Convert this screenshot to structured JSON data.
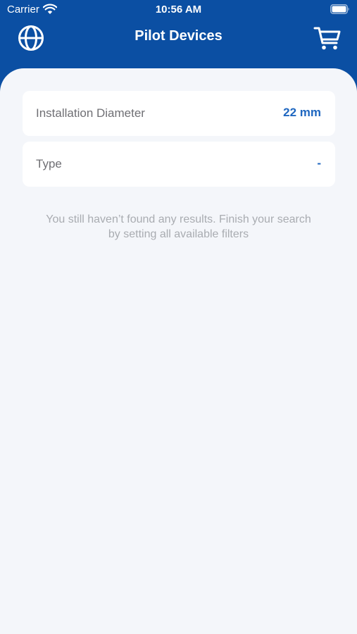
{
  "status_bar": {
    "carrier": "Carrier",
    "time": "10:56 AM"
  },
  "nav": {
    "title": "Pilot Devices",
    "left_icon": "globe-icon",
    "right_icon": "cart-icon"
  },
  "filters": [
    {
      "label": "Installation Diameter",
      "value": "22 mm"
    },
    {
      "label": "Type",
      "value": "-"
    }
  ],
  "empty_message": "You still haven’t found any results. Finish your search by setting all available filters",
  "colors": {
    "header_background": "#0b4fa3",
    "content_background": "#f4f6fa",
    "accent_value": "#1f67c0",
    "label_text": "#6f6f74",
    "hint_text": "#a9acb1"
  }
}
